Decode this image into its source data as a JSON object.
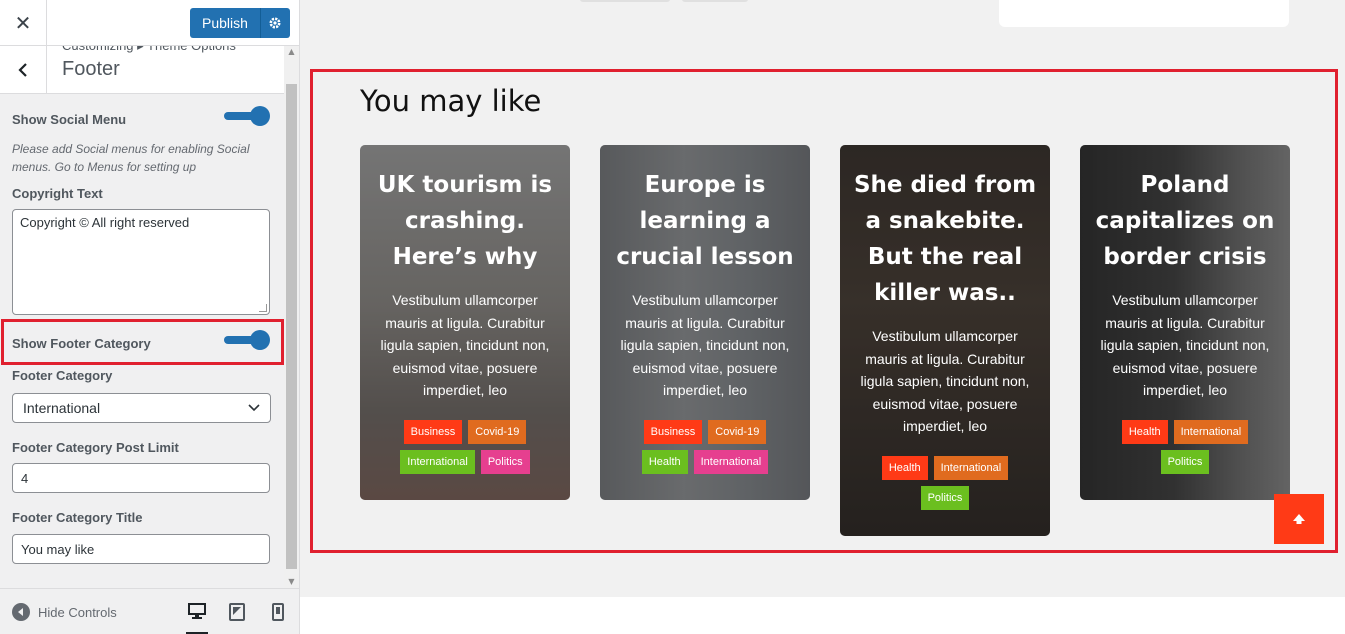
{
  "header": {
    "publish_label": "Publish"
  },
  "section": {
    "breadcrumb": "Customizing ▸ Theme Options",
    "title": "Footer"
  },
  "controls": {
    "show_social_menu": {
      "label": "Show Social Menu",
      "enabled": true
    },
    "social_desc": "Please add Social menus for enabling Social menus. Go to Menus for setting up",
    "copyright": {
      "label": "Copyright Text",
      "value": "Copyright © All right reserved"
    },
    "show_footer_category": {
      "label": "Show Footer Category",
      "enabled": true
    },
    "footer_category": {
      "label": "Footer Category",
      "value": "International"
    },
    "post_limit": {
      "label": "Footer Category Post Limit",
      "value": "4"
    },
    "category_title": {
      "label": "Footer Category Title",
      "value": "You may like"
    }
  },
  "footer_bar": {
    "hide_controls": "Hide Controls"
  },
  "preview": {
    "heading": "You may like",
    "cards": [
      {
        "title": "UK tourism is crashing. Here’s why",
        "excerpt": "Vestibulum ullamcorper mauris at ligula. Curabitur ligula sapien, tincidunt non, euismod vitae, posuere imperdiet, leo",
        "tags": [
          "Business",
          "Covid-19",
          "International",
          "Politics"
        ]
      },
      {
        "title": "Europe is learning a crucial lesson",
        "excerpt": "Vestibulum ullamcorper mauris at ligula. Curabitur ligula sapien, tincidunt non, euismod vitae, posuere imperdiet, leo",
        "tags": [
          "Business",
          "Covid-19",
          "Health",
          "International"
        ]
      },
      {
        "title": "She died from a snakebite. But the real killer was..",
        "excerpt": "Vestibulum ullamcorper mauris at ligula. Curabitur ligula sapien, tincidunt non, euismod vitae, posuere imperdiet, leo",
        "tags": [
          "Health",
          "International",
          "Politics"
        ]
      },
      {
        "title": "Poland capitalizes on border crisis",
        "excerpt": "Vestibulum ullamcorper mauris at ligula. Curabitur ligula sapien, tincidunt non, euismod vitae, posuere imperdiet, leo",
        "tags": [
          "Health",
          "International",
          "Politics"
        ]
      }
    ]
  },
  "colors": {
    "accent": "#2271b1",
    "highlight": "#e0202f",
    "to_top": "#ff3a16",
    "tag_business": "#ff3a16",
    "tag_covid": "#e06b1f",
    "tag_international_dark": "#e06b1f",
    "tag_international_green": "#6bbf1f",
    "tag_politics_pink": "#e63f8f",
    "tag_politics_green": "#6bbf1f",
    "tag_health_green": "#6bbf1f",
    "tag_health_red": "#ff3a16",
    "tag_international_pink": "#e63f8f"
  }
}
